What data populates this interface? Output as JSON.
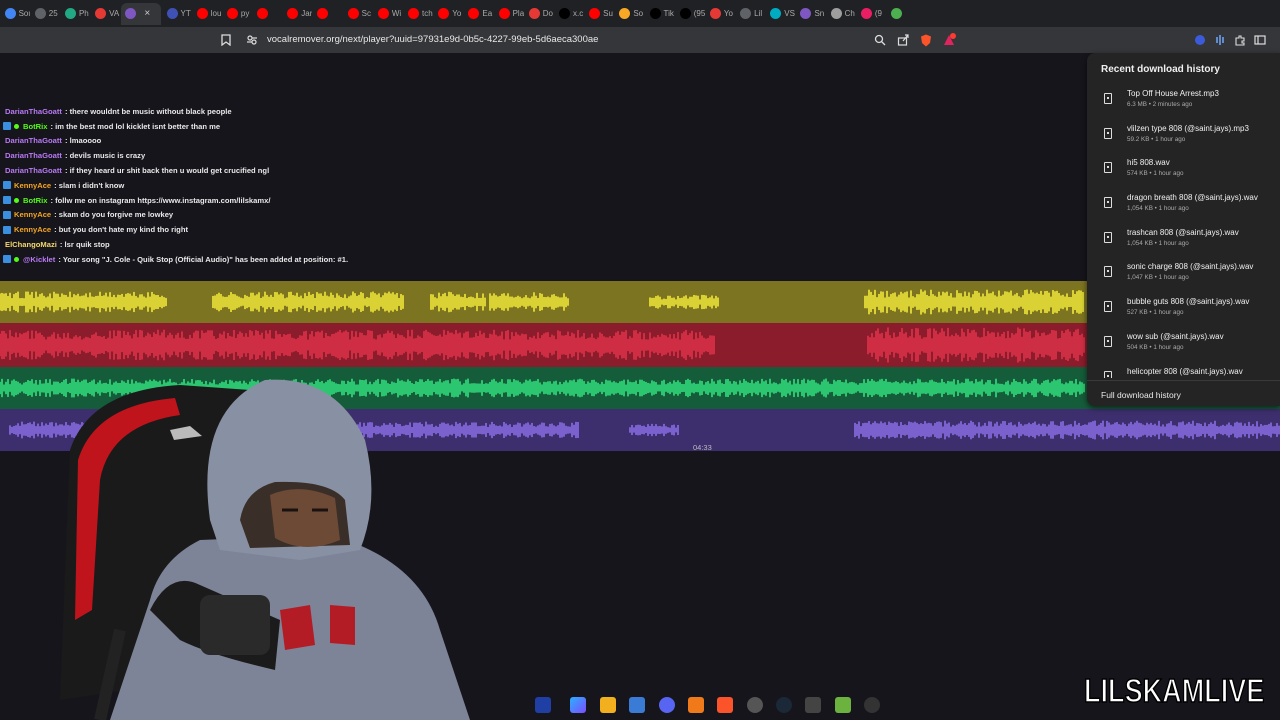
{
  "browser": {
    "tabs": [
      {
        "label": "Sou",
        "color": "#4285f4"
      },
      {
        "label": "25",
        "color": "#5f6368"
      },
      {
        "label": "Ph",
        "color": "#22a884"
      },
      {
        "label": "VA",
        "color": "#e53935"
      },
      {
        "label": "",
        "color": "#7e57c2",
        "active": true
      },
      {
        "label": "YT",
        "color": "#3f51b5"
      },
      {
        "label": "lou",
        "color": "#ff0000"
      },
      {
        "label": "py",
        "color": "#ff0000"
      },
      {
        "label": "",
        "color": "#ff0000"
      },
      {
        "label": "Jar",
        "color": "#ff0000"
      },
      {
        "label": "",
        "color": "#ff0000"
      },
      {
        "label": "Sc",
        "color": "#ff0000"
      },
      {
        "label": "Wi",
        "color": "#ff0000"
      },
      {
        "label": "tch",
        "color": "#ff0000"
      },
      {
        "label": "Yo",
        "color": "#ff0000"
      },
      {
        "label": "Ea",
        "color": "#ff0000"
      },
      {
        "label": "Pla",
        "color": "#ff0000"
      },
      {
        "label": "Do",
        "color": "#e53935"
      },
      {
        "label": "x.c",
        "color": "#000000"
      },
      {
        "label": "Su",
        "color": "#ff0000"
      },
      {
        "label": "So",
        "color": "#f9a825"
      },
      {
        "label": "Tik",
        "color": "#000000"
      },
      {
        "label": "(95",
        "color": "#000000"
      },
      {
        "label": "Yo",
        "color": "#e53935"
      },
      {
        "label": "Lil",
        "color": "#5f6368"
      },
      {
        "label": "VS",
        "color": "#00acc1"
      },
      {
        "label": "Sn",
        "color": "#7e57c2"
      },
      {
        "label": "Ch",
        "color": "#9e9e9e"
      },
      {
        "label": "(9",
        "color": "#e91e63"
      },
      {
        "label": "",
        "color": "#4caf50"
      }
    ],
    "url": "vocalremover.org/next/player?uuid=97931e9d-0b5c-4227-99eb-5d6aeca300ae"
  },
  "chat": [
    {
      "user": "DarianThaGoatt",
      "user_color": "#b97af5",
      "msg": ": there wouldnt be music without black people",
      "badge": false,
      "bot": false
    },
    {
      "user": "BotRix",
      "user_color": "#53fc18",
      "msg": ": im the best mod lol kicklet isnt better than me",
      "badge": true,
      "bot": true
    },
    {
      "user": "DarianThaGoatt",
      "user_color": "#b97af5",
      "msg": ": lmaoooo",
      "badge": false,
      "bot": false
    },
    {
      "user": "DarianThaGoatt",
      "user_color": "#b97af5",
      "msg": ": devils music is crazy",
      "badge": false,
      "bot": false
    },
    {
      "user": "DarianThaGoatt",
      "user_color": "#b97af5",
      "msg": ": if they heard ur shit back then u would get crucified ngl",
      "badge": false,
      "bot": false
    },
    {
      "user": "KennyAce",
      "user_color": "#f5a623",
      "msg": ": slam i didn't know",
      "badge": true,
      "bot": false
    },
    {
      "user": "BotRix",
      "user_color": "#53fc18",
      "msg": ": follw me on instagram https://www.instagram.com/lilskamx/",
      "badge": true,
      "bot": true
    },
    {
      "user": "KennyAce",
      "user_color": "#f5a623",
      "msg": ": skam do you forgive me lowkey",
      "badge": true,
      "bot": false
    },
    {
      "user": "KennyAce",
      "user_color": "#f5a623",
      "msg": ": but you don't hate my kind tho right",
      "badge": true,
      "bot": false
    },
    {
      "user": "ElChangoMazi",
      "user_color": "#f5d76e",
      "msg": ": lsr quik stop",
      "badge": false,
      "bot": false
    },
    {
      "user": "@Kicklet",
      "user_color": "#b97af5",
      "msg": ": Your song \"J. Cole - Quik Stop (Official Audio)\" has been added at position: #1.",
      "badge": true,
      "bot": true
    }
  ],
  "player": {
    "time": "04:33",
    "track_colors": {
      "vocals": "#f2ea3a",
      "drums": "#e0324a",
      "bass": "#33e07f",
      "other": "#8b6ee6"
    }
  },
  "downloads": {
    "title": "Recent download history",
    "items": [
      {
        "name": "Top Off  House Arrest.mp3",
        "meta": "6.3 MB • 2 minutes ago"
      },
      {
        "name": "vlilzen type 808 (@saint.jays).mp3",
        "meta": "59.2 KB • 1 hour ago"
      },
      {
        "name": "hi5 808.wav",
        "meta": "574 KB • 1 hour ago"
      },
      {
        "name": "dragon breath 808 (@saint.jays).wav",
        "meta": "1,054 KB • 1 hour ago"
      },
      {
        "name": "trashcan 808 (@saint.jays).wav",
        "meta": "1,054 KB • 1 hour ago"
      },
      {
        "name": "sonic charge 808 (@saint.jays).wav",
        "meta": "1,047 KB • 1 hour ago"
      },
      {
        "name": "bubble guts 808 (@saint.jays).wav",
        "meta": "527 KB • 1 hour ago"
      },
      {
        "name": "wow sub (@saint.jays).wav",
        "meta": "504 KB • 1 hour ago"
      },
      {
        "name": "helicopter 808 (@saint.jays).wav",
        "meta": ""
      }
    ],
    "full_link": "Full download history"
  },
  "overlay": {
    "brand": "LILSKAMLIVE"
  }
}
